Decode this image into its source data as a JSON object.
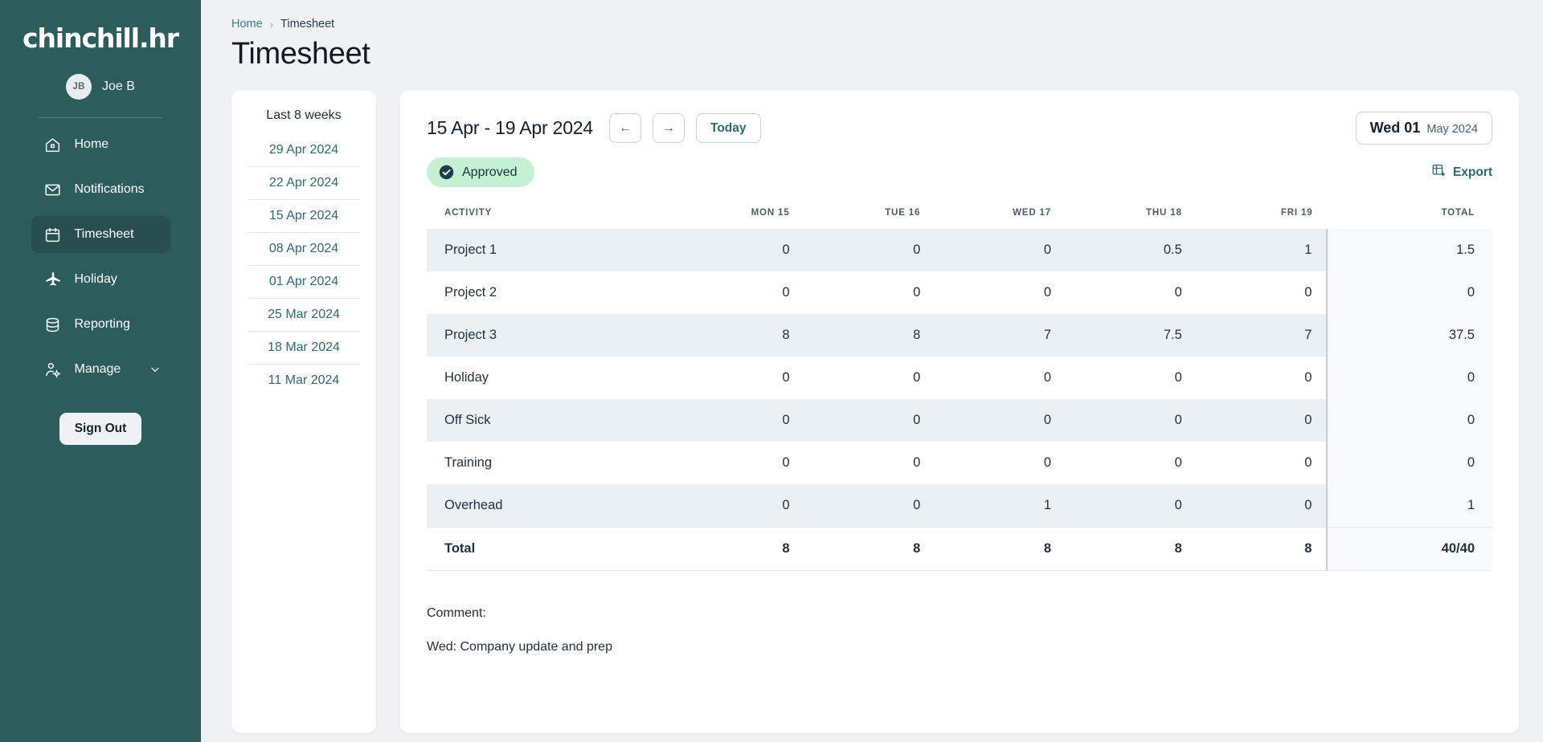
{
  "sidebar": {
    "logo": "chinchill.hr",
    "user": {
      "initials": "JB",
      "name": "Joe B"
    },
    "items": [
      {
        "label": "Home",
        "icon": "home-icon",
        "active": false,
        "chevron": false
      },
      {
        "label": "Notifications",
        "icon": "envelope-icon",
        "active": false,
        "chevron": false
      },
      {
        "label": "Timesheet",
        "icon": "calendar-icon",
        "active": true,
        "chevron": false
      },
      {
        "label": "Holiday",
        "icon": "airplane-icon",
        "active": false,
        "chevron": false
      },
      {
        "label": "Reporting",
        "icon": "database-icon",
        "active": false,
        "chevron": false
      },
      {
        "label": "Manage",
        "icon": "user-settings-icon",
        "active": false,
        "chevron": true
      }
    ],
    "sign_out_label": "Sign Out"
  },
  "breadcrumb": {
    "home": "Home",
    "separator": "›",
    "current": "Timesheet"
  },
  "page_title": "Timesheet",
  "weeks_panel": {
    "title": "Last 8 weeks",
    "items": [
      "29 Apr 2024",
      "22 Apr 2024",
      "15 Apr 2024",
      "08 Apr 2024",
      "01 Apr 2024",
      "25 Mar 2024",
      "18 Mar 2024",
      "11 Mar 2024"
    ]
  },
  "timesheet": {
    "range_title": "15 Apr - 19 Apr 2024",
    "prev_label": "←",
    "next_label": "→",
    "today_label": "Today",
    "date_pill": {
      "day": "Wed 01",
      "rest": "May 2024"
    },
    "status_label": "Approved",
    "export_label": "Export",
    "columns": [
      "ACTIVITY",
      "MON 15",
      "TUE 16",
      "WED 17",
      "THU 18",
      "FRI 19",
      "TOTAL"
    ],
    "rows": [
      {
        "activity": "Project 1",
        "values": [
          "0",
          "0",
          "0",
          "0.5",
          "1"
        ],
        "total": "1.5"
      },
      {
        "activity": "Project 2",
        "values": [
          "0",
          "0",
          "0",
          "0",
          "0"
        ],
        "total": "0"
      },
      {
        "activity": "Project 3",
        "values": [
          "8",
          "8",
          "7",
          "7.5",
          "7"
        ],
        "total": "37.5"
      },
      {
        "activity": "Holiday",
        "values": [
          "0",
          "0",
          "0",
          "0",
          "0"
        ],
        "total": "0"
      },
      {
        "activity": "Off Sick",
        "values": [
          "0",
          "0",
          "0",
          "0",
          "0"
        ],
        "total": "0"
      },
      {
        "activity": "Training",
        "values": [
          "0",
          "0",
          "0",
          "0",
          "0"
        ],
        "total": "0"
      },
      {
        "activity": "Overhead",
        "values": [
          "0",
          "0",
          "1",
          "0",
          "0"
        ],
        "total": "1"
      }
    ],
    "total_row": {
      "activity": "Total",
      "values": [
        "8",
        "8",
        "8",
        "8",
        "8"
      ],
      "total": "40/40"
    },
    "comment_label": "Comment:",
    "comment_text": "Wed: Company update and prep"
  },
  "colors": {
    "sidebar_bg": "#2c5c5c",
    "sidebar_active": "#274f4f",
    "page_bg": "#eef2f5",
    "accent_teal": "#2e6b6b",
    "badge_bg": "#c3f1d2",
    "zebra": "#eaf0f4"
  }
}
